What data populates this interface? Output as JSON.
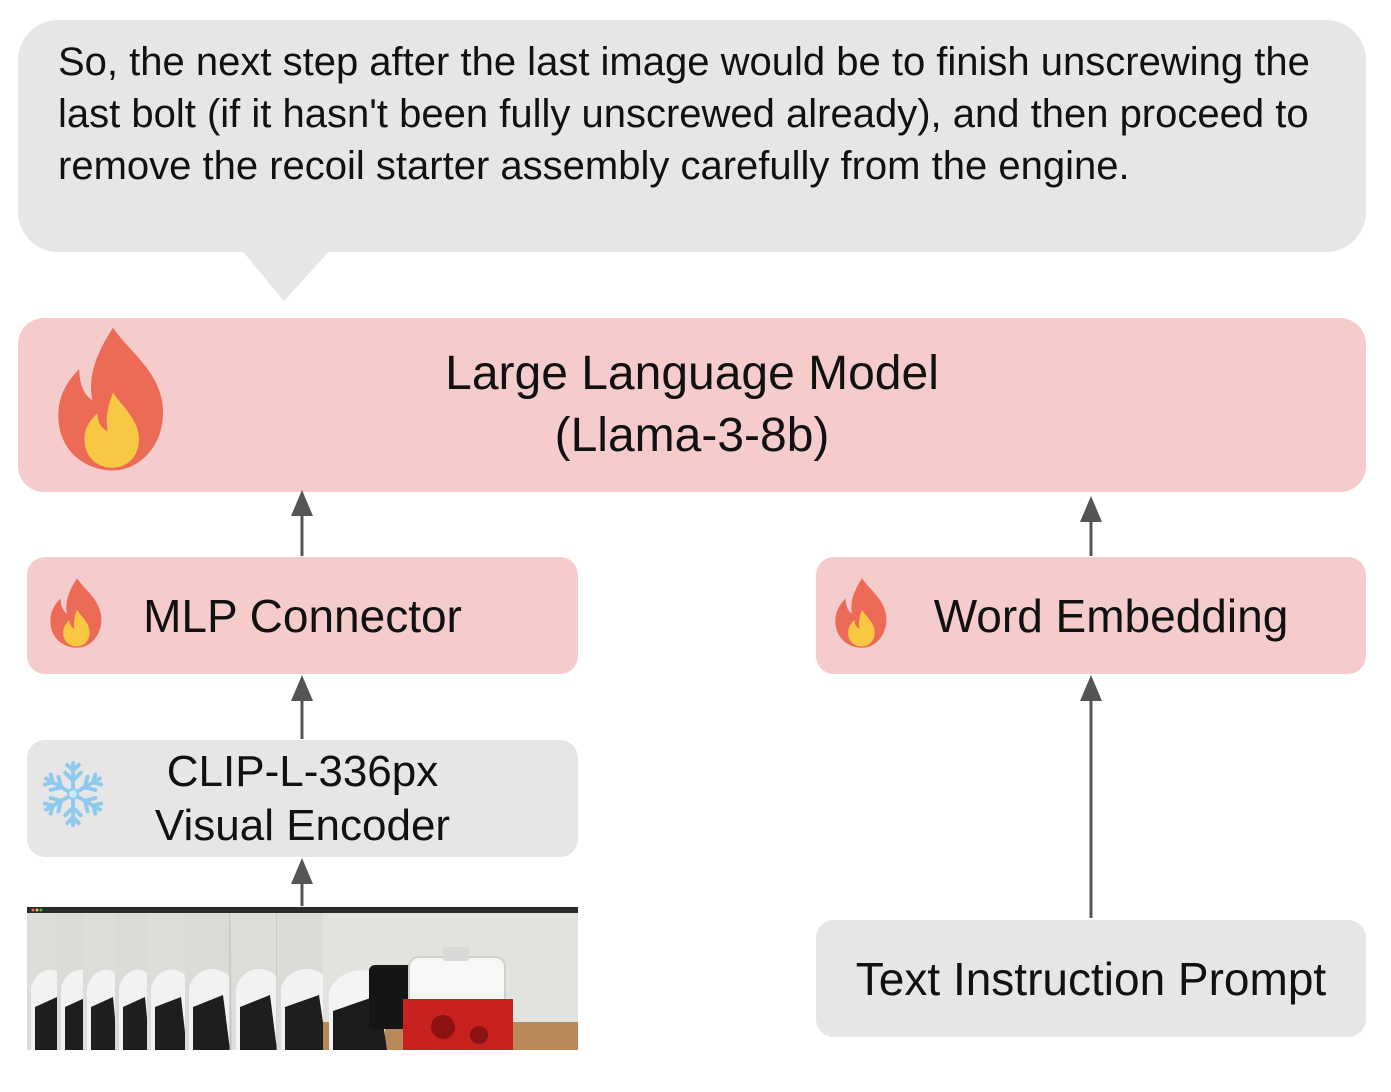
{
  "bubble": {
    "text": "So, the next step after the last image would be to finish unscrewing the last bolt (if it hasn't been fully unscrewed already), and then proceed to remove the recoil starter assembly carefully from the engine."
  },
  "llm": {
    "line1": "Large Language Model",
    "line2": "(Llama-3-8b)",
    "icon": "fire-icon"
  },
  "mlp": {
    "label": "MLP Connector",
    "icon": "fire-icon"
  },
  "word_embedding": {
    "label": "Word Embedding",
    "icon": "fire-icon"
  },
  "clip": {
    "line1": "CLIP-L-336px",
    "line2": "Visual Encoder",
    "icon": "snowflake-icon"
  },
  "prompt": {
    "label": "Text Instruction Prompt"
  },
  "frames": {
    "icon": "video-frames-image"
  },
  "colors": {
    "trainable": "#f6cbcb",
    "frozen": "#e6e6e6",
    "arrow": "#555555"
  }
}
